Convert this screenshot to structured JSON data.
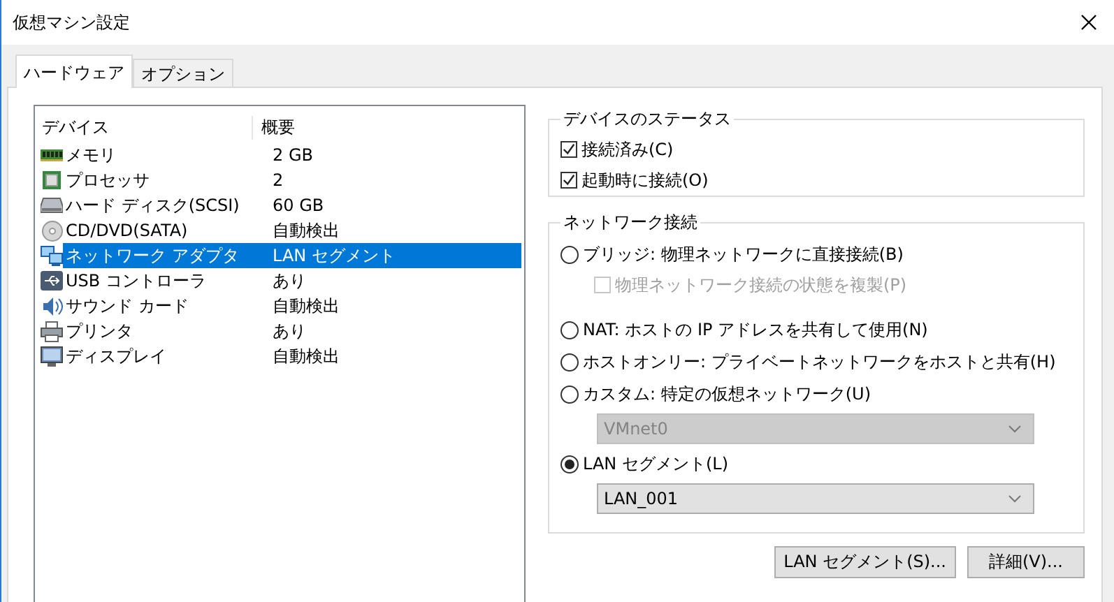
{
  "window": {
    "title": "仮想マシン設定"
  },
  "tabs": [
    {
      "label": "ハードウェア",
      "selected": true
    },
    {
      "label": "オプション",
      "selected": false
    }
  ],
  "device_list": {
    "columns": [
      "デバイス",
      "概要"
    ],
    "rows": [
      {
        "kind": "memory",
        "name": "メモリ",
        "summary": "2 GB",
        "selected": false
      },
      {
        "kind": "processor",
        "name": "プロセッサ",
        "summary": "2",
        "selected": false
      },
      {
        "kind": "disk",
        "name": "ハード ディスク(SCSI)",
        "summary": "60 GB",
        "selected": false
      },
      {
        "kind": "cd",
        "name": "CD/DVD(SATA)",
        "summary": "自動検出",
        "selected": false
      },
      {
        "kind": "network",
        "name": "ネットワーク アダプタ",
        "summary": "LAN セグメント",
        "selected": true
      },
      {
        "kind": "usb",
        "name": "USB コントローラ",
        "summary": "あり",
        "selected": false
      },
      {
        "kind": "sound",
        "name": "サウンド カード",
        "summary": "自動検出",
        "selected": false
      },
      {
        "kind": "printer",
        "name": "プリンタ",
        "summary": "あり",
        "selected": false
      },
      {
        "kind": "display",
        "name": "ディスプレイ",
        "summary": "自動検出",
        "selected": false
      }
    ]
  },
  "device_status": {
    "title": "デバイスのステータス",
    "options": [
      {
        "label": "接続済み(C)",
        "checked": true
      },
      {
        "label": "起動時に接続(O)",
        "checked": true
      }
    ]
  },
  "network_connection": {
    "title": "ネットワーク接続",
    "options": [
      {
        "kind": "radio",
        "label": "ブリッジ: 物理ネットワークに直接接続(B)",
        "selected": false
      },
      {
        "kind": "checkbox",
        "label": "物理ネットワーク接続の状態を複製(P)",
        "checked": false,
        "disabled": true
      },
      {
        "kind": "radio",
        "label": "NAT: ホストの IP アドレスを共有して使用(N)",
        "selected": false
      },
      {
        "kind": "radio",
        "label": "ホストオンリー: プライベートネットワークをホストと共有(H)",
        "selected": false
      },
      {
        "kind": "radio",
        "label": "カスタム: 特定の仮想ネットワーク(U)",
        "selected": false
      },
      {
        "kind": "select",
        "value": "VMnet0",
        "disabled": true
      },
      {
        "kind": "radio",
        "label": "LAN セグメント(L)",
        "selected": true
      },
      {
        "kind": "select",
        "value": "LAN_001",
        "disabled": false
      }
    ]
  },
  "buttons": [
    "LAN セグメント(S)...",
    "詳細(V)..."
  ]
}
